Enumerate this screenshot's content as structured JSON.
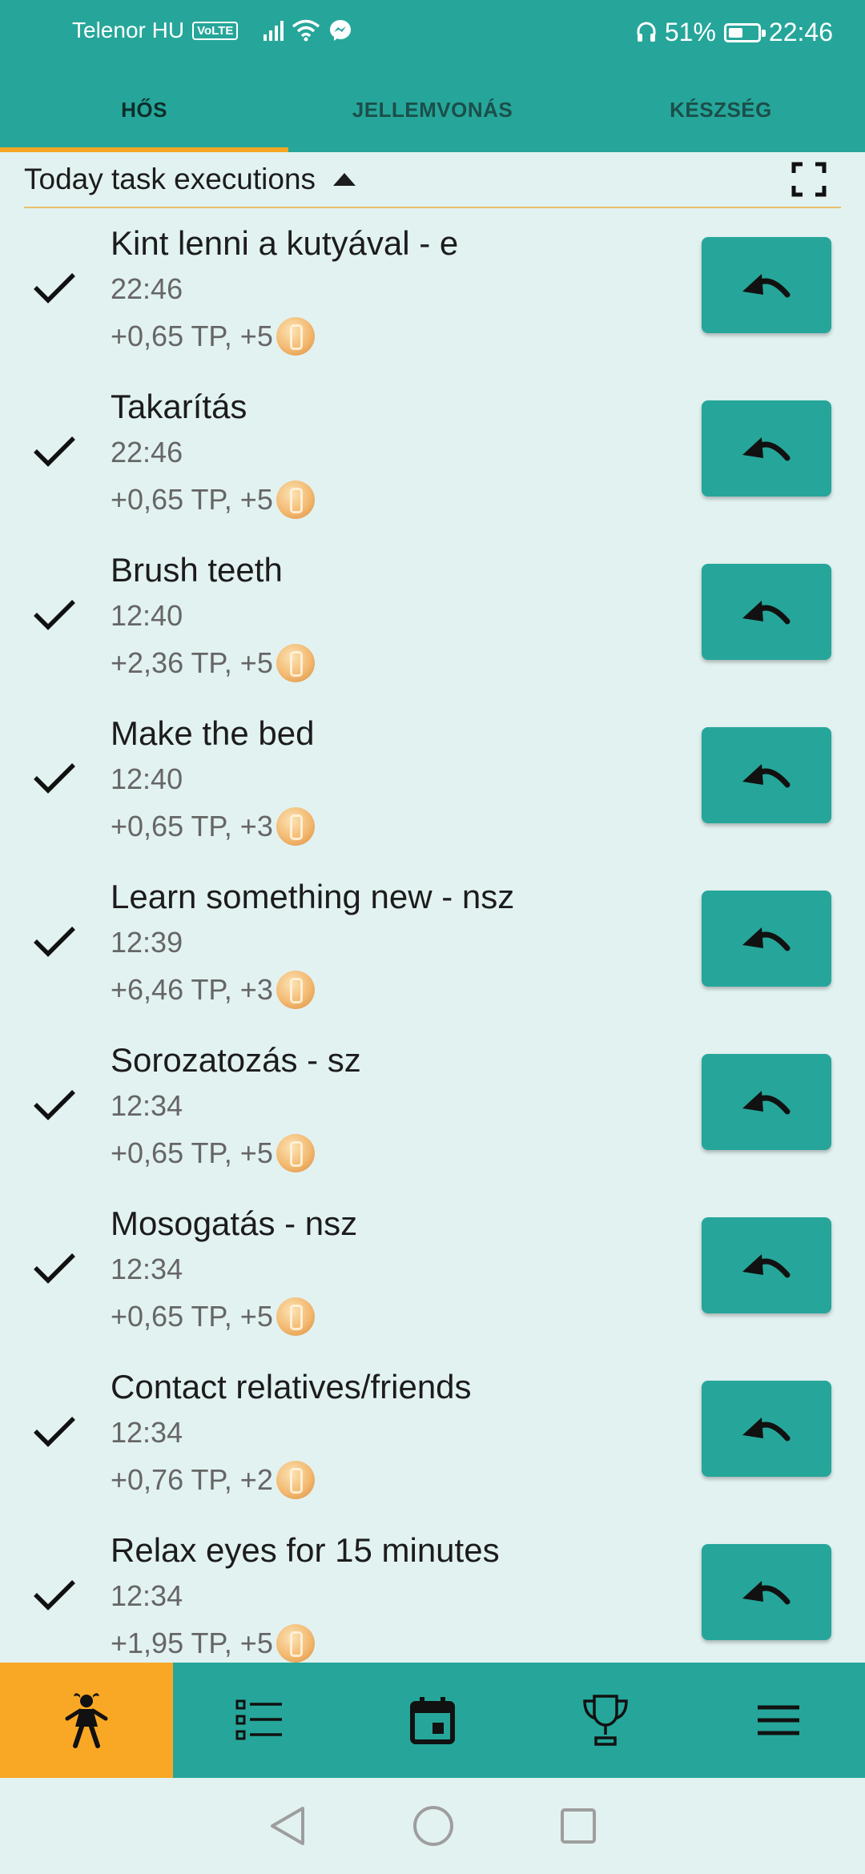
{
  "status_bar": {
    "carrier": "Telenor HU",
    "volte": "VoLTE",
    "battery_percent": "51%",
    "battery_level": 0.51,
    "time": "22:46"
  },
  "tabs": [
    {
      "label": "HŐS",
      "active": true
    },
    {
      "label": "JELLEMVONÁS",
      "active": false
    },
    {
      "label": "KÉSZSÉG",
      "active": false
    }
  ],
  "section": {
    "title": "Today task executions"
  },
  "tasks": [
    {
      "title": "Kint lenni a kutyával - e",
      "time": "22:46",
      "reward": "+0,65 TP, +5"
    },
    {
      "title": "Takarítás",
      "time": "22:46",
      "reward": "+0,65 TP, +5"
    },
    {
      "title": "Brush teeth",
      "time": "12:40",
      "reward": "+2,36 TP, +5"
    },
    {
      "title": "Make the bed",
      "time": "12:40",
      "reward": "+0,65 TP, +3"
    },
    {
      "title": "Learn something new - nsz",
      "time": "12:39",
      "reward": "+6,46 TP, +3"
    },
    {
      "title": "Sorozatozás - sz",
      "time": "12:34",
      "reward": "+0,65 TP, +5"
    },
    {
      "title": "Mosogatás - nsz",
      "time": "12:34",
      "reward": "+0,65 TP, +5"
    },
    {
      "title": "Contact relatives/friends",
      "time": "12:34",
      "reward": "+0,76 TP, +2"
    },
    {
      "title": "Relax eyes for 15 minutes",
      "time": "12:34",
      "reward": "+1,95 TP, +5"
    }
  ],
  "bottom_nav": [
    {
      "icon": "hero-icon",
      "active": true
    },
    {
      "icon": "list-icon",
      "active": false
    },
    {
      "icon": "calendar-icon",
      "active": false
    },
    {
      "icon": "trophy-icon",
      "active": false
    },
    {
      "icon": "menu-icon",
      "active": false
    }
  ],
  "colors": {
    "primary": "#26a69a",
    "accent": "#f9a825",
    "background": "#e2f2f1"
  }
}
